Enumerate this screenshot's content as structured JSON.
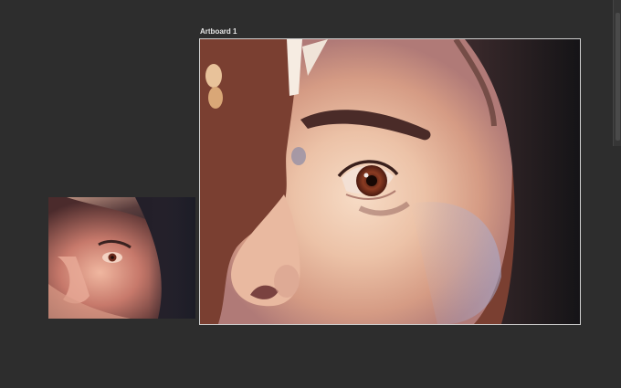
{
  "artboard": {
    "title": "Artboard 1"
  },
  "colors": {
    "workspace_background": "#2d2d2d",
    "canvas_background": "#7a3f31",
    "artboard_border": "#cfcfcf",
    "swatch_light": "#e8c29a",
    "swatch_mid": "#d9a777"
  },
  "icons": {
    "scrollbar": "vertical-scrollbar"
  }
}
